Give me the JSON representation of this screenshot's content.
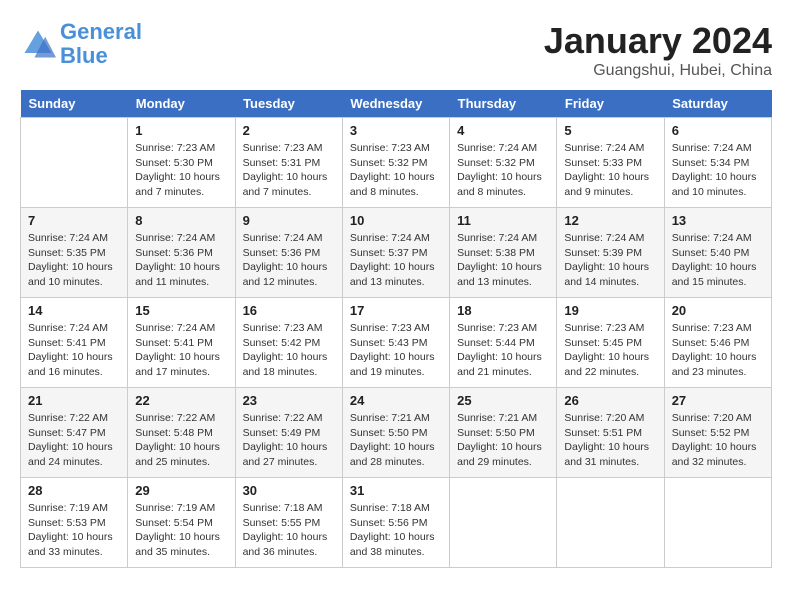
{
  "header": {
    "logo_line1": "General",
    "logo_line2": "Blue",
    "month_title": "January 2024",
    "subtitle": "Guangshui, Hubei, China"
  },
  "weekdays": [
    "Sunday",
    "Monday",
    "Tuesday",
    "Wednesday",
    "Thursday",
    "Friday",
    "Saturday"
  ],
  "weeks": [
    [
      {
        "day": "",
        "info": ""
      },
      {
        "day": "1",
        "info": "Sunrise: 7:23 AM\nSunset: 5:30 PM\nDaylight: 10 hours\nand 7 minutes."
      },
      {
        "day": "2",
        "info": "Sunrise: 7:23 AM\nSunset: 5:31 PM\nDaylight: 10 hours\nand 7 minutes."
      },
      {
        "day": "3",
        "info": "Sunrise: 7:23 AM\nSunset: 5:32 PM\nDaylight: 10 hours\nand 8 minutes."
      },
      {
        "day": "4",
        "info": "Sunrise: 7:24 AM\nSunset: 5:32 PM\nDaylight: 10 hours\nand 8 minutes."
      },
      {
        "day": "5",
        "info": "Sunrise: 7:24 AM\nSunset: 5:33 PM\nDaylight: 10 hours\nand 9 minutes."
      },
      {
        "day": "6",
        "info": "Sunrise: 7:24 AM\nSunset: 5:34 PM\nDaylight: 10 hours\nand 10 minutes."
      }
    ],
    [
      {
        "day": "7",
        "info": "Sunrise: 7:24 AM\nSunset: 5:35 PM\nDaylight: 10 hours\nand 10 minutes."
      },
      {
        "day": "8",
        "info": "Sunrise: 7:24 AM\nSunset: 5:36 PM\nDaylight: 10 hours\nand 11 minutes."
      },
      {
        "day": "9",
        "info": "Sunrise: 7:24 AM\nSunset: 5:36 PM\nDaylight: 10 hours\nand 12 minutes."
      },
      {
        "day": "10",
        "info": "Sunrise: 7:24 AM\nSunset: 5:37 PM\nDaylight: 10 hours\nand 13 minutes."
      },
      {
        "day": "11",
        "info": "Sunrise: 7:24 AM\nSunset: 5:38 PM\nDaylight: 10 hours\nand 13 minutes."
      },
      {
        "day": "12",
        "info": "Sunrise: 7:24 AM\nSunset: 5:39 PM\nDaylight: 10 hours\nand 14 minutes."
      },
      {
        "day": "13",
        "info": "Sunrise: 7:24 AM\nSunset: 5:40 PM\nDaylight: 10 hours\nand 15 minutes."
      }
    ],
    [
      {
        "day": "14",
        "info": "Sunrise: 7:24 AM\nSunset: 5:41 PM\nDaylight: 10 hours\nand 16 minutes."
      },
      {
        "day": "15",
        "info": "Sunrise: 7:24 AM\nSunset: 5:41 PM\nDaylight: 10 hours\nand 17 minutes."
      },
      {
        "day": "16",
        "info": "Sunrise: 7:23 AM\nSunset: 5:42 PM\nDaylight: 10 hours\nand 18 minutes."
      },
      {
        "day": "17",
        "info": "Sunrise: 7:23 AM\nSunset: 5:43 PM\nDaylight: 10 hours\nand 19 minutes."
      },
      {
        "day": "18",
        "info": "Sunrise: 7:23 AM\nSunset: 5:44 PM\nDaylight: 10 hours\nand 21 minutes."
      },
      {
        "day": "19",
        "info": "Sunrise: 7:23 AM\nSunset: 5:45 PM\nDaylight: 10 hours\nand 22 minutes."
      },
      {
        "day": "20",
        "info": "Sunrise: 7:23 AM\nSunset: 5:46 PM\nDaylight: 10 hours\nand 23 minutes."
      }
    ],
    [
      {
        "day": "21",
        "info": "Sunrise: 7:22 AM\nSunset: 5:47 PM\nDaylight: 10 hours\nand 24 minutes."
      },
      {
        "day": "22",
        "info": "Sunrise: 7:22 AM\nSunset: 5:48 PM\nDaylight: 10 hours\nand 25 minutes."
      },
      {
        "day": "23",
        "info": "Sunrise: 7:22 AM\nSunset: 5:49 PM\nDaylight: 10 hours\nand 27 minutes."
      },
      {
        "day": "24",
        "info": "Sunrise: 7:21 AM\nSunset: 5:50 PM\nDaylight: 10 hours\nand 28 minutes."
      },
      {
        "day": "25",
        "info": "Sunrise: 7:21 AM\nSunset: 5:50 PM\nDaylight: 10 hours\nand 29 minutes."
      },
      {
        "day": "26",
        "info": "Sunrise: 7:20 AM\nSunset: 5:51 PM\nDaylight: 10 hours\nand 31 minutes."
      },
      {
        "day": "27",
        "info": "Sunrise: 7:20 AM\nSunset: 5:52 PM\nDaylight: 10 hours\nand 32 minutes."
      }
    ],
    [
      {
        "day": "28",
        "info": "Sunrise: 7:19 AM\nSunset: 5:53 PM\nDaylight: 10 hours\nand 33 minutes."
      },
      {
        "day": "29",
        "info": "Sunrise: 7:19 AM\nSunset: 5:54 PM\nDaylight: 10 hours\nand 35 minutes."
      },
      {
        "day": "30",
        "info": "Sunrise: 7:18 AM\nSunset: 5:55 PM\nDaylight: 10 hours\nand 36 minutes."
      },
      {
        "day": "31",
        "info": "Sunrise: 7:18 AM\nSunset: 5:56 PM\nDaylight: 10 hours\nand 38 minutes."
      },
      {
        "day": "",
        "info": ""
      },
      {
        "day": "",
        "info": ""
      },
      {
        "day": "",
        "info": ""
      }
    ]
  ]
}
